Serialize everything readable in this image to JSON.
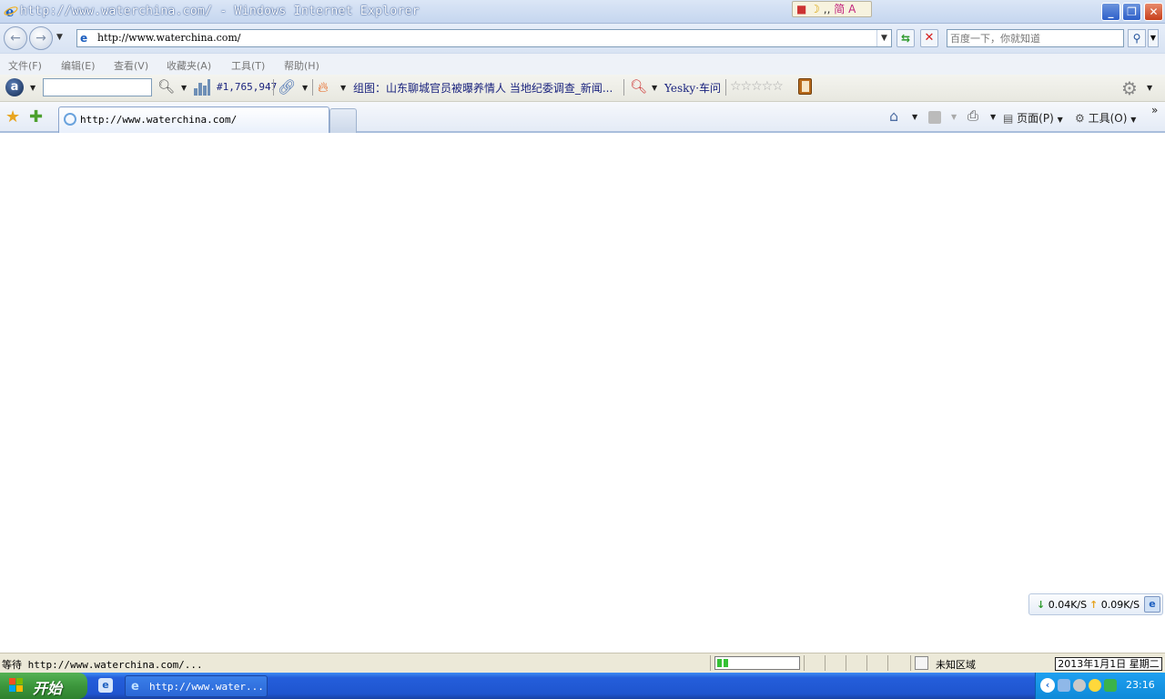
{
  "window": {
    "title": "http://www.waterchina.com/ - Windows Internet Explorer",
    "ime": {
      "mode": "简",
      "letter": "A"
    }
  },
  "address": {
    "url": "http://www.waterchina.com/",
    "search_placeholder": "百度一下，你就知道"
  },
  "menu": {
    "items": [
      "文件(F)",
      "编辑(E)",
      "查看(V)",
      "收藏夹(A)",
      "工具(T)",
      "帮助(H)"
    ]
  },
  "toolbar": {
    "alexa_rank": "#1,765,947",
    "news_link": "组图：山东聊城官员被曝养情人 当地纪委调查_新闻...",
    "yesky_link": "Yesky·车问",
    "stars": "☆☆☆☆☆"
  },
  "tabs": {
    "active_label": "http://www.waterchina.com/",
    "page_label": "页面(P)",
    "tools_label": "工具(O)"
  },
  "speed": {
    "down": "0.04K/S",
    "up": "0.09K/S"
  },
  "status": {
    "text": "等待 http://www.waterchina.com/...",
    "zone": "未知区域",
    "date": "2013年1月1日 星期二",
    "progress": 0.15
  },
  "taskbar": {
    "start_label": "开始",
    "task_label": "http://www.water...",
    "clock": "23:16"
  },
  "colors": {
    "taskbar_blue": "#245edb",
    "start_green": "#3c963c",
    "link_navy": "#1a237e"
  }
}
